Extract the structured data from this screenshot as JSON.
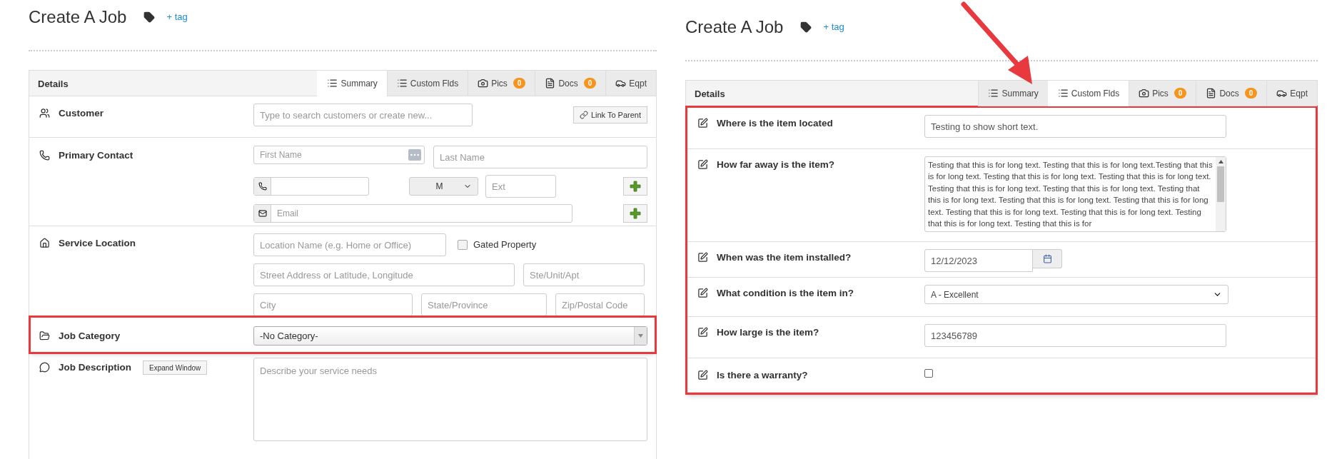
{
  "panels": [
    {
      "title": "Create A Job",
      "tag_link": "+ tag",
      "section": "Details",
      "highlighted": false,
      "arrow": false,
      "tabs": [
        {
          "label": "Summary",
          "kind": "list",
          "selected": true
        },
        {
          "label": "Custom Flds",
          "kind": "list",
          "selected": false
        },
        {
          "label": "Pics",
          "kind": "camera",
          "badge": "0",
          "selected": false
        },
        {
          "label": "Docs",
          "kind": "doc",
          "badge": "0",
          "selected": false
        },
        {
          "label": "Eqpt",
          "kind": "car",
          "selected": false
        }
      ],
      "rows": [
        {
          "kind": "customer",
          "label": "Customer",
          "placeholder": "Type to search customers or create new...",
          "button": "Link To Parent"
        },
        {
          "kind": "contact",
          "label": "Primary Contact",
          "first": {
            "placeholder": "First Name"
          },
          "last": {
            "placeholder": "Last Name"
          },
          "phone_type": "M",
          "ext": {
            "placeholder": "Ext"
          },
          "email": {
            "placeholder": "Email"
          }
        },
        {
          "kind": "location",
          "label": "Service Location",
          "location_name": {
            "placeholder": "Location Name (e.g. Home or Office)"
          },
          "gated": {
            "label": "Gated Property",
            "checked": false
          },
          "street": {
            "placeholder": "Street Address or Latitude, Longitude"
          },
          "unit": {
            "placeholder": "Ste/Unit/Apt"
          },
          "city": {
            "placeholder": "City"
          },
          "state": {
            "placeholder": "State/Province"
          },
          "zip": {
            "placeholder": "Zip/Postal Code"
          }
        },
        {
          "kind": "category",
          "label": "Job Category",
          "value": "-No Category-",
          "highlighted": true
        },
        {
          "kind": "description",
          "label": "Job Description",
          "button": "Expand Window",
          "placeholder": "Describe your service needs"
        }
      ]
    },
    {
      "title": "Create A Job",
      "tag_link": "+ tag",
      "section": "Details",
      "highlighted": true,
      "arrow": true,
      "tabs": [
        {
          "label": "Summary",
          "kind": "list",
          "selected": false
        },
        {
          "label": "Custom Flds",
          "kind": "list",
          "selected": true
        },
        {
          "label": "Pics",
          "kind": "camera",
          "badge": "0",
          "selected": false
        },
        {
          "label": "Docs",
          "kind": "doc",
          "badge": "0",
          "selected": false
        },
        {
          "label": "Eqpt",
          "kind": "car",
          "selected": false
        }
      ],
      "rows": [
        {
          "kind": "text",
          "label": "Where is the item located",
          "value": "Testing to show short text."
        },
        {
          "kind": "longtext",
          "label": "How far away is the item?",
          "value": "Testing that this is for long text. Testing that this is for long text.Testing that this is for long text. Testing that this is for long text. Testing that this is for long text. Testing that this is for long text. Testing that this is for long text. Testing that this is for long text. Testing that this is for long text. Testing that this is for long text. Testing that this is for long text. Testing that this is for long text. Testing that this is for long text. Testing that this is for"
        },
        {
          "kind": "date",
          "label": "When was the item installed?",
          "value": "12/12/2023"
        },
        {
          "kind": "select",
          "label": "What condition is the item in?",
          "value": "A - Excellent"
        },
        {
          "kind": "text",
          "label": "How large is the item?",
          "value": "123456789"
        },
        {
          "kind": "checkbox",
          "label": "Is there a warranty?",
          "checked": false
        }
      ]
    }
  ]
}
